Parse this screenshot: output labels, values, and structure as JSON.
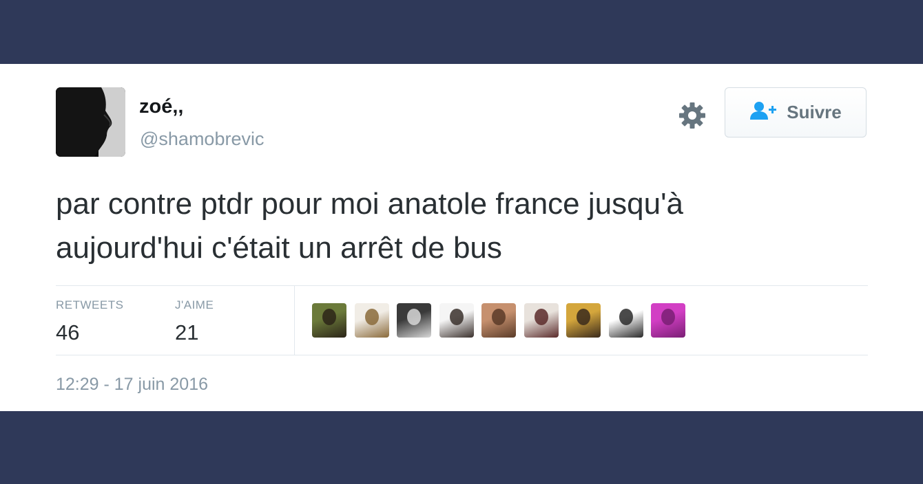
{
  "author": {
    "name": "zoé,,",
    "handle": "@shamobrevic"
  },
  "follow_button": {
    "label": "Suivre",
    "icon": "follow-user-icon"
  },
  "settings_icon": "gear-icon",
  "tweet": {
    "line1": "par contre ptdr pour moi anatole france jusqu'à",
    "line2": "aujourd'hui c'était un arrêt de bus"
  },
  "stats": {
    "retweets_label": "RETWEETS",
    "retweets_count": "46",
    "likes_label": "J'AIME",
    "likes_count": "21"
  },
  "liker_avatars": [
    {
      "name": "liker-avatar-1",
      "colors": [
        "#6b7a3a",
        "#2b2418"
      ]
    },
    {
      "name": "liker-avatar-2",
      "colors": [
        "#f1ede6",
        "#8a6a3a"
      ]
    },
    {
      "name": "liker-avatar-3",
      "colors": [
        "#3a3a3a",
        "#d8d8d8"
      ]
    },
    {
      "name": "liker-avatar-4",
      "colors": [
        "#f5f5f5",
        "#3a302c"
      ]
    },
    {
      "name": "liker-avatar-5",
      "colors": [
        "#c6906e",
        "#5a3b28"
      ]
    },
    {
      "name": "liker-avatar-6",
      "colors": [
        "#e8e2dc",
        "#5a2a2a"
      ]
    },
    {
      "name": "liker-avatar-7",
      "colors": [
        "#d4a63c",
        "#3a2a1c"
      ]
    },
    {
      "name": "liker-avatar-8",
      "colors": [
        "#ffffff",
        "#2a2a2a"
      ]
    },
    {
      "name": "liker-avatar-9",
      "colors": [
        "#d23fc4",
        "#7a1f74"
      ]
    }
  ],
  "timestamp": "12:29 - 17 juin 2016",
  "colors": {
    "band": "#2f3959",
    "accent": "#1da1f2"
  }
}
